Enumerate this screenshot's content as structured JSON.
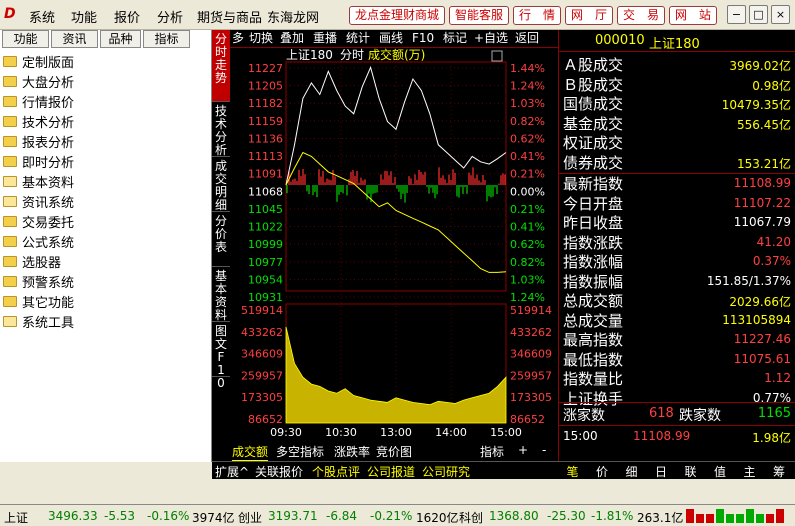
{
  "app": {
    "logo": "D",
    "menus": [
      "系统",
      "功能",
      "报价",
      "分析",
      "期货与商品",
      "东海龙网"
    ],
    "red_buttons": [
      "龙点金理财商城",
      "智能客服",
      "行　情",
      "网　厅",
      "交　易",
      "网　站"
    ],
    "window_buttons": [
      "−",
      "□",
      "×"
    ]
  },
  "sidebar": {
    "tabs": [
      "功能",
      "资讯",
      "品种",
      "指标"
    ],
    "items": [
      {
        "label": "定制版面",
        "open": false
      },
      {
        "label": "大盘分析",
        "open": false
      },
      {
        "label": "行情报价",
        "open": false
      },
      {
        "label": "技术分析",
        "open": false
      },
      {
        "label": "报表分析",
        "open": false
      },
      {
        "label": "即时分析",
        "open": false
      },
      {
        "label": "基本资料",
        "open": true
      },
      {
        "label": "资讯系统",
        "open": true
      },
      {
        "label": "交易委托",
        "open": false
      },
      {
        "label": "公式系统",
        "open": false
      },
      {
        "label": "选股器",
        "open": false
      },
      {
        "label": "预警系统",
        "open": false
      },
      {
        "label": "其它功能",
        "open": false
      },
      {
        "label": "系统工具",
        "open": true
      }
    ]
  },
  "vtabs": [
    "分时走势",
    "技术分析",
    "成交明细",
    "分价表",
    "基本资料",
    "图文F10"
  ],
  "toolbar": [
    "多",
    "切换",
    "叠加",
    "重播",
    "统计",
    "画线",
    "F10",
    "标记",
    "+自选",
    "返回"
  ],
  "chart": {
    "header": {
      "name": "上证180",
      "mode": "分时",
      "volume_label": "成交额(万)"
    },
    "left_ticks": [
      "11227",
      "11205",
      "11182",
      "11159",
      "11136",
      "11113",
      "11091",
      "11068",
      "11045",
      "11022",
      "10999",
      "10977",
      "10954",
      "10931"
    ],
    "right_ticks": [
      "1.44%",
      "1.24%",
      "1.03%",
      "0.82%",
      "0.62%",
      "0.41%",
      "0.21%",
      "0.00%",
      "0.21%",
      "0.41%",
      "0.62%",
      "0.82%",
      "1.03%",
      "1.24%"
    ],
    "vol_ticks": [
      "519914",
      "433262",
      "346609",
      "259957",
      "173305",
      "86652"
    ],
    "x_ticks": [
      "09:30",
      "10:30",
      "13:00",
      "14:00",
      "15:00"
    ]
  },
  "chart_data": {
    "type": "line",
    "title": "上证180",
    "prev_close": 11068,
    "ylim": [
      10931,
      11227
    ],
    "series": [
      {
        "values": [
          11068,
          11120,
          11180,
          11200,
          11185,
          11215,
          11190,
          11170,
          11160,
          11195,
          11220,
          11180,
          11150,
          11140,
          11175,
          11205,
          11190,
          11160,
          11120,
          11110,
          11100,
          11090,
          11105,
          11098,
          11095,
          11102,
          11110
        ]
      },
      {
        "values": [
          11068,
          11090,
          11110,
          11105,
          11095,
          11085,
          11080,
          11075,
          11070,
          11060,
          11050,
          11040,
          11045,
          11035,
          11030,
          11025,
          11020,
          11015,
          11010,
          11000,
          10990,
          10980,
          10970,
          10960,
          10955,
          10955,
          10956
        ]
      }
    ],
    "volume": [
      420000,
      260000,
      200000,
      170000,
      160000,
      140000,
      130000,
      150000,
      120000,
      110000,
      100000,
      95000,
      90000,
      110000,
      100000,
      90000,
      85000,
      80000,
      95000,
      90000,
      85000,
      100000,
      110000,
      120000,
      130000,
      160000,
      200000
    ]
  },
  "bottom_tabs": {
    "row1": [
      "成交额",
      "多空指标",
      "涨跌率",
      "竞价图",
      "指标",
      "+",
      "-"
    ],
    "row2": [
      "扩展^",
      "关联报价",
      "个股点评",
      "公司报道",
      "公司研究"
    ]
  },
  "quote": {
    "code": "000010",
    "name": "上证180",
    "rows": [
      {
        "label": "Ａ股成交",
        "value": "3969.02亿",
        "color": "#ffff00"
      },
      {
        "label": "Ｂ股成交",
        "value": "0.98亿",
        "color": "#ffff00"
      },
      {
        "label": "国债成交",
        "value": "10479.35亿",
        "color": "#ffff00"
      },
      {
        "label": "基金成交",
        "value": "556.45亿",
        "color": "#ffff00"
      },
      {
        "label": "权证成交",
        "value": "",
        "color": "#ffff00"
      },
      {
        "label": "债券成交",
        "value": "153.21亿",
        "color": "#ffff00"
      },
      {
        "label": "最新指数",
        "value": "11108.99",
        "color": "#ff4040"
      },
      {
        "label": "今日开盘",
        "value": "11107.22",
        "color": "#ff4040"
      },
      {
        "label": "昨日收盘",
        "value": "11067.79",
        "color": "#ffffff"
      },
      {
        "label": "指数涨跌",
        "value": "41.20",
        "color": "#ff4040"
      },
      {
        "label": "指数涨幅",
        "value": "0.37%",
        "color": "#ff4040"
      },
      {
        "label": "指数振幅",
        "value": "151.85/1.37%",
        "color": "#ffffff"
      },
      {
        "label": "总成交额",
        "value": "2029.66亿",
        "color": "#ffff00"
      },
      {
        "label": "总成交量",
        "value": "113105894",
        "color": "#ffff00"
      },
      {
        "label": "最高指数",
        "value": "11227.46",
        "color": "#ff4040"
      },
      {
        "label": "最低指数",
        "value": "11075.61",
        "color": "#ff4040"
      },
      {
        "label": "指数量比",
        "value": "1.12",
        "color": "#ff4040"
      },
      {
        "label": "上证换手",
        "value": "0.77%",
        "color": "#ffffff"
      }
    ],
    "up_label": "涨家数",
    "up_value": "618",
    "down_label": "跌家数",
    "down_value": "1165",
    "tick_time": "15:00",
    "tick_price": "11108.99",
    "tick_vol": "1.98亿"
  },
  "right_tabs": [
    "笔",
    "价",
    "细",
    "日",
    "联",
    "值",
    "主",
    "筹"
  ],
  "status": [
    {
      "name": "上证",
      "price": "3496.33",
      "chg": "-5.53",
      "pct": "-0.16%",
      "vol": "3974亿"
    },
    {
      "name": "创业",
      "price": "3193.71",
      "chg": "-6.84",
      "pct": "-0.21%",
      "vol": "1620亿"
    },
    {
      "name": "科创",
      "price": "1368.80",
      "chg": "-25.30",
      "pct": "-1.81%",
      "vol": "263.1亿"
    }
  ]
}
